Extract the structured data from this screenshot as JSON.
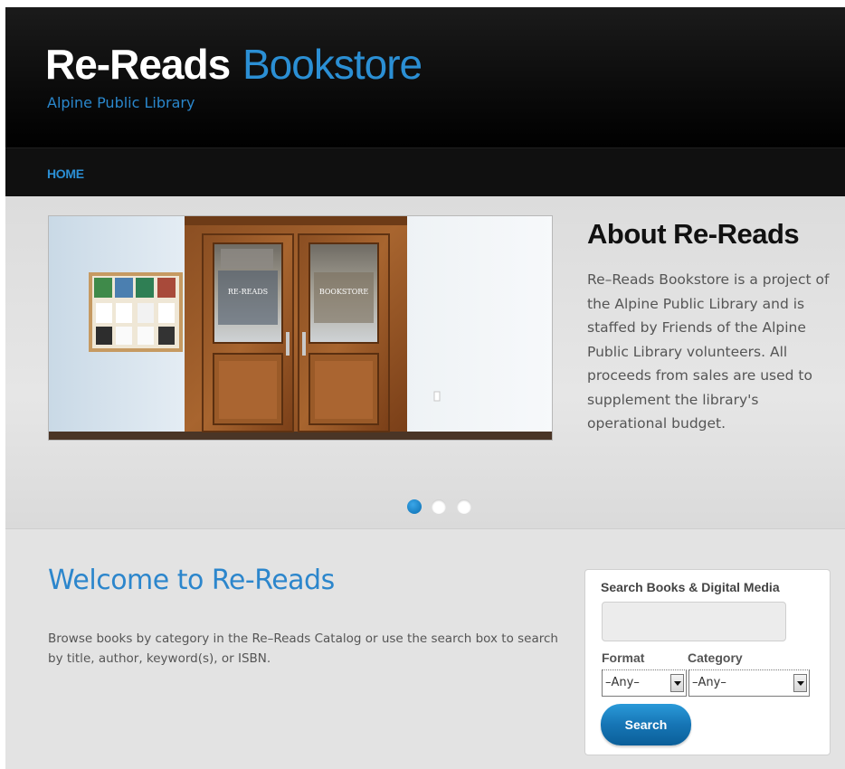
{
  "header": {
    "title_part1": "Re-Reads",
    "title_part2": "Bookstore",
    "subtitle": "Alpine Public Library"
  },
  "nav": {
    "home_label": "HOME"
  },
  "hero": {
    "image_signs": {
      "left": "RE-READS",
      "right": "BOOKSTORE"
    },
    "about_title": "About Re-Reads",
    "about_text": "Re–Reads Bookstore is a project of the Alpine Public Library and is staffed by Friends of the Alpine Public Library volunteers. All proceeds from sales are used to supplement the library's operational budget.",
    "slides_count": 3,
    "active_slide": 1
  },
  "welcome": {
    "title": "Welcome to Re-Reads",
    "text": "Browse books by category in the Re–Reads Catalog or use the search box to search by title, author, keyword(s), or ISBN."
  },
  "search": {
    "heading": "Search Books & Digital Media",
    "input_value": "",
    "format_label": "Format",
    "format_value": "–Any–",
    "category_label": "Category",
    "category_value": "–Any–",
    "button_label": "Search"
  },
  "colors": {
    "accent_blue": "#2b8fd4",
    "header_bg": "#000000",
    "button_blue": "#1675b5"
  }
}
